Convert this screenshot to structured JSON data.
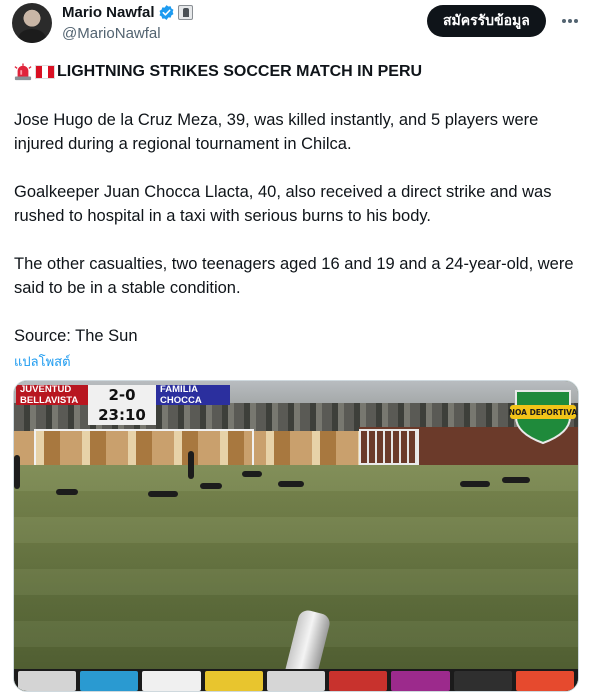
{
  "author": {
    "display_name": "Mario Nawfal",
    "handle": "@MarioNawfal"
  },
  "header": {
    "subscribe_label": "สมัครรับข้อมูล"
  },
  "tweet": {
    "headline": "LIGHTNING STRIKES SOCCER MATCH IN PERU",
    "paragraphs": [
      "Jose Hugo de la Cruz Meza, 39, was killed instantly, and 5 players were injured during a regional tournament in Chilca.",
      "Goalkeeper Juan Chocca Llacta, 40, also received a direct strike and was rushed to hospital in a taxi with serious burns to his body.",
      "The other casualties, two teenagers aged 16 and 19 and a 24-year-old, were said to be in a stable condition.",
      "Source: The Sun"
    ],
    "translate_label": "แปลโพสต์"
  },
  "media": {
    "scoreboard": {
      "home_team": "JUVENTUD BELLAVISTA",
      "away_team": "FAMILIA CHOCCA",
      "score": "2-0",
      "clock": "23:10"
    },
    "logo_text": "NOA DEPORTIVA"
  },
  "colors": {
    "accent": "#1d9bf0",
    "verified": "#1d9bf0",
    "button_bg": "#0f1419",
    "home_team": "#b81620",
    "away_team": "#2b2f9e",
    "flag_red": "#d91023"
  },
  "icons": {
    "verified": "verified-badge-icon",
    "affiliate": "affiliate-badge-icon",
    "more": "more-options-icon",
    "siren": "siren-emoji-icon",
    "flag": "peru-flag-emoji-icon"
  }
}
